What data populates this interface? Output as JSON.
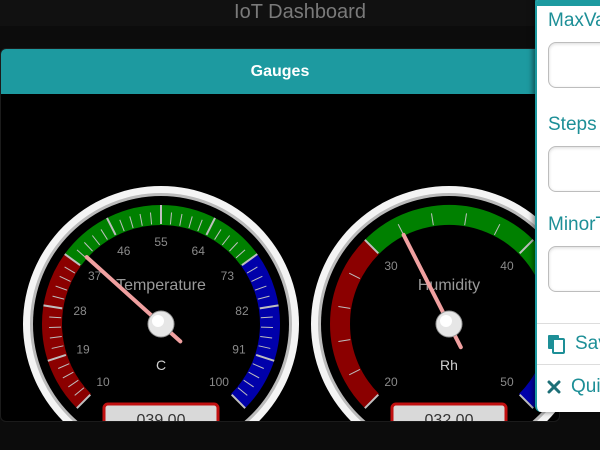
{
  "app": {
    "title": "IoT Dashboard"
  },
  "panel": {
    "title": "Gauges"
  },
  "gauges": [
    {
      "id": "temperature",
      "title": "Temperature",
      "unit": "C",
      "value_display": "039.00",
      "value": 39,
      "min": 10,
      "max": 100,
      "ticks": [
        "10",
        "19",
        "28",
        "37",
        "46",
        "55",
        "64",
        "73",
        "82",
        "91",
        "100"
      ],
      "bands": [
        {
          "from": 10,
          "to": 37,
          "color": "#8b0000"
        },
        {
          "from": 37,
          "to": 73,
          "color": "#008000"
        },
        {
          "from": 73,
          "to": 100,
          "color": "#0000aa"
        }
      ]
    },
    {
      "id": "humidity",
      "title": "Humidity",
      "unit": "Rh",
      "value_display": "032.00",
      "value": 32,
      "min": 20,
      "max": 50,
      "ticks": [
        "20",
        "30",
        "40",
        "50"
      ],
      "bands": [
        {
          "from": 20,
          "to": 30,
          "color": "#8b0000"
        },
        {
          "from": 30,
          "to": 45,
          "color": "#008000"
        },
        {
          "from": 45,
          "to": 50,
          "color": "#0000aa"
        }
      ]
    }
  ],
  "settings": {
    "fields": [
      {
        "label": "MaxValue",
        "value": ""
      },
      {
        "label": "Steps",
        "value": ""
      },
      {
        "label": "MinorTicks",
        "value": ""
      }
    ],
    "save_label": "Save",
    "quit_label": "Quit"
  },
  "colors": {
    "accent": "#1d9aa0",
    "needle": "#f0a0a0",
    "odometer_border": "#c01010"
  }
}
